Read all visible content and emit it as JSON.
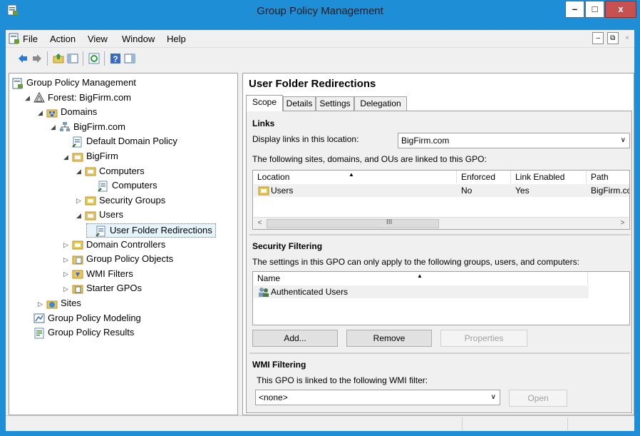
{
  "window": {
    "title": "Group Policy Management",
    "icon": "gpmc-icon",
    "buttons": {
      "minimize": "–",
      "maximize": "□",
      "close": "x"
    }
  },
  "menu": {
    "items": [
      "File",
      "Action",
      "View",
      "Window",
      "Help"
    ],
    "mdi": {
      "minimize": "–",
      "restore": "⧉",
      "close": "×"
    }
  },
  "toolbar": {
    "icons": [
      "back-arrow-icon",
      "forward-arrow-icon",
      "up-folder-icon",
      "show-hide-console-tree-icon",
      "refresh-icon",
      "help-icon",
      "action-pane-icon"
    ]
  },
  "tree": {
    "items": [
      {
        "label": "Group Policy Management",
        "level": 0,
        "arrow": "",
        "icon": "gpmc-icon"
      },
      {
        "label": "Forest: BigFirm.com",
        "level": 1,
        "arrow": "◢",
        "icon": "forest-icon"
      },
      {
        "label": "Domains",
        "level": 2,
        "arrow": "◢",
        "icon": "domains-icon"
      },
      {
        "label": "BigFirm.com",
        "level": 3,
        "arrow": "◢",
        "icon": "domain-icon"
      },
      {
        "label": "Default Domain Policy",
        "level": 4,
        "arrow": "",
        "icon": "gpo-link-icon"
      },
      {
        "label": "BigFirm",
        "level": 4,
        "arrow": "◢",
        "icon": "ou-icon"
      },
      {
        "label": "Computers",
        "level": 5,
        "arrow": "◢",
        "icon": "ou-icon"
      },
      {
        "label": "Computers",
        "level": 6,
        "arrow": "",
        "icon": "gpo-link-icon"
      },
      {
        "label": "Security Groups",
        "level": 5,
        "arrow": "▷",
        "icon": "ou-icon"
      },
      {
        "label": "Users",
        "level": 5,
        "arrow": "◢",
        "icon": "ou-icon"
      },
      {
        "label": "User Folder Redirections",
        "level": 6,
        "arrow": "",
        "icon": "gpo-link-icon",
        "selected": true
      },
      {
        "label": "Domain Controllers",
        "level": 4,
        "arrow": "▷",
        "icon": "ou-icon"
      },
      {
        "label": "Group Policy Objects",
        "level": 4,
        "arrow": "▷",
        "icon": "gpo-container-icon"
      },
      {
        "label": "WMI Filters",
        "level": 4,
        "arrow": "▷",
        "icon": "wmi-icon"
      },
      {
        "label": "Starter GPOs",
        "level": 4,
        "arrow": "▷",
        "icon": "starter-gpo-icon"
      },
      {
        "label": "Sites",
        "level": 2,
        "arrow": "▷",
        "icon": "sites-icon"
      },
      {
        "label": "Group Policy Modeling",
        "level": 1,
        "arrow": "",
        "icon": "modeling-icon"
      },
      {
        "label": "Group Policy Results",
        "level": 1,
        "arrow": "",
        "icon": "results-icon"
      }
    ]
  },
  "details": {
    "title": "User Folder Redirections",
    "tabs": [
      "Scope",
      "Details",
      "Settings",
      "Delegation"
    ],
    "active_tab": "Scope",
    "links": {
      "heading": "Links",
      "display_label": "Display links in this location:",
      "location_value": "BigFirm.com",
      "description": "The following sites, domains, and OUs are linked to this GPO:",
      "columns": [
        "Location",
        "Enforced",
        "Link Enabled",
        "Path"
      ],
      "rows": [
        {
          "location": "Users",
          "enforced": "No",
          "link_enabled": "Yes",
          "path": "BigFirm.co"
        }
      ],
      "scroll_thumb_text": "III"
    },
    "security": {
      "heading": "Security Filtering",
      "description": "The settings in this GPO can only apply to the following groups, users, and computers:",
      "columns": [
        "Name"
      ],
      "rows": [
        "Authenticated Users"
      ],
      "buttons": {
        "add": "Add...",
        "remove": "Remove",
        "properties": "Properties"
      }
    },
    "wmi": {
      "heading": "WMI Filtering",
      "description": "This GPO is linked to the following WMI filter:",
      "filter_value": "<none>",
      "open_button": "Open"
    }
  },
  "colors": {
    "titlebar": "#1e8fd6",
    "close": "#c75050",
    "selection": "#e5f3fb"
  }
}
